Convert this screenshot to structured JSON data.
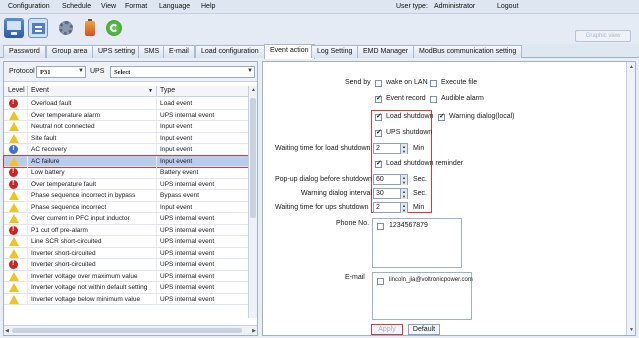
{
  "menu": {
    "items": [
      "Configuration",
      "Schedule",
      "View",
      "Format",
      "Language",
      "Help"
    ],
    "user_type_label": "User type:",
    "user_type_value": "Administrator",
    "logout": "Logout"
  },
  "toolbar": {
    "icons": [
      "monitor-icon",
      "configuration-icon",
      "gear-icon",
      "battery-icon",
      "refresh-icon"
    ],
    "graphic_view": "Graphic view"
  },
  "tabs": [
    "Password",
    "Group area",
    "UPS setting",
    "SMS",
    "E-mail",
    "Load configuration",
    "Event action",
    "Log Setting",
    "EMD Manager",
    "ModBus communication setting"
  ],
  "active_tab": "Event action",
  "filter": {
    "protocol_label": "Protocol",
    "protocol_value": "P31",
    "ups_label": "UPS",
    "ups_value": "Select"
  },
  "grid": {
    "columns": [
      "Level",
      "Event",
      "Type"
    ],
    "rows": [
      {
        "level": "error",
        "event": "Overload fault",
        "type": "Load event"
      },
      {
        "level": "warning",
        "event": "Over temperature alarm",
        "type": "UPS internal event"
      },
      {
        "level": "warning",
        "event": "Neutral not connected",
        "type": "Input event"
      },
      {
        "level": "warning",
        "event": "Site fault",
        "type": "Input event"
      },
      {
        "level": "info",
        "event": "AC recovery",
        "type": "Input event"
      },
      {
        "level": "warning",
        "event": "AC failure",
        "type": "Input event",
        "selected": true
      },
      {
        "level": "error",
        "event": "Low battery",
        "type": "Battery event"
      },
      {
        "level": "error",
        "event": "Over temperature fault",
        "type": "UPS internal event"
      },
      {
        "level": "warning",
        "event": "Phase sequence incorrect in bypass",
        "type": "Bypass event"
      },
      {
        "level": "warning",
        "event": "Phase sequence incorrect",
        "type": "Input event"
      },
      {
        "level": "warning",
        "event": "Over current in PFC input inductor",
        "type": "UPS internal event"
      },
      {
        "level": "error",
        "event": "P1 cut off pre-alarm",
        "type": "UPS internal event"
      },
      {
        "level": "warning",
        "event": "Line SCR short-circuited",
        "type": "UPS internal event"
      },
      {
        "level": "warning",
        "event": "Inverter short-circuited",
        "type": "UPS internal event"
      },
      {
        "level": "error",
        "event": "Inverter short-circuited",
        "type": "UPS internal event"
      },
      {
        "level": "warning",
        "event": "Inverter voltage over maximum value",
        "type": "UPS internal event"
      },
      {
        "level": "warning",
        "event": "Inverter voltage not within default setting",
        "type": "UPS internal event"
      },
      {
        "level": "warning",
        "event": "Inverter voltage below minimum value",
        "type": "UPS internal event"
      }
    ]
  },
  "settings": {
    "send_by_label": "Send by",
    "wake_on_lan": "wake on LAN",
    "execute_file": "Execute file",
    "event_record": "Event record",
    "audible_alarm": "Audible alarm",
    "load_shutdown": "Load shutdown",
    "warning_dialog": "Warning dialog(local)",
    "ups_shutdown": "UPS shutdown",
    "wait_load_label": "Waiting time for load shutdown",
    "wait_load_value": "2",
    "min_unit": "Min",
    "load_shutdown_reminder": "Load shutdown reminder",
    "popup_label": "Pop-up dialog before shutdown",
    "popup_value": "60",
    "sec_unit": "Sec.",
    "warn_interval_label": "Warning dialog interval",
    "warn_interval_value": "30",
    "wait_ups_label": "Waiting time for ups shutdown",
    "wait_ups_value": "2",
    "phone_label": "Phone No.",
    "phone_value": "1234567879",
    "email_label": "E-mail",
    "email_value": "lincoln_jia@voltronicpower.com",
    "apply": "Apply",
    "default": "Default"
  }
}
